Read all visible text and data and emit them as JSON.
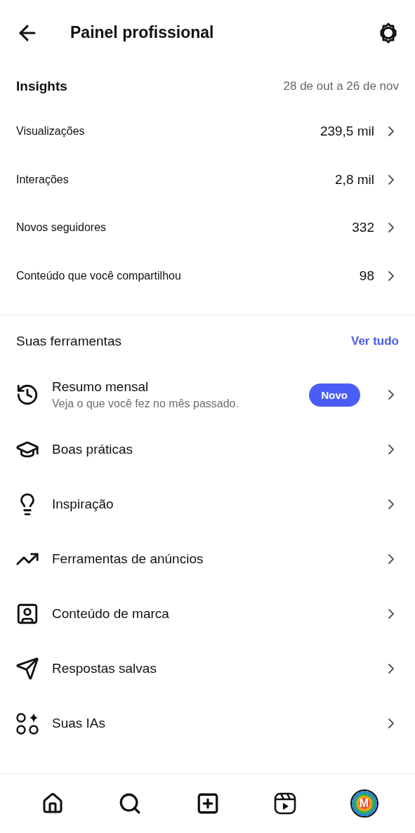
{
  "header": {
    "title": "Painel profissional"
  },
  "insights": {
    "title": "Insights",
    "date_range": "28 de out a 26 de nov",
    "rows": [
      {
        "label": "Visualizações",
        "value": "239,5 mil"
      },
      {
        "label": "Interações",
        "value": "2,8 mil"
      },
      {
        "label": "Novos seguidores",
        "value": "332"
      },
      {
        "label": "Conteúdo que você compartilhou",
        "value": "98"
      }
    ]
  },
  "tools": {
    "title": "Suas ferramentas",
    "link": "Ver tudo",
    "items": [
      {
        "label": "Resumo mensal",
        "subtitle": "Veja o que você fez no mês passado.",
        "badge": "Novo"
      },
      {
        "label": "Boas práticas"
      },
      {
        "label": "Inspiração"
      },
      {
        "label": "Ferramentas de anúncios"
      },
      {
        "label": "Conteúdo de marca"
      },
      {
        "label": "Respostas salvas"
      },
      {
        "label": "Suas IAs"
      }
    ]
  },
  "bottom_nav": {
    "avatar_letter": "M"
  }
}
